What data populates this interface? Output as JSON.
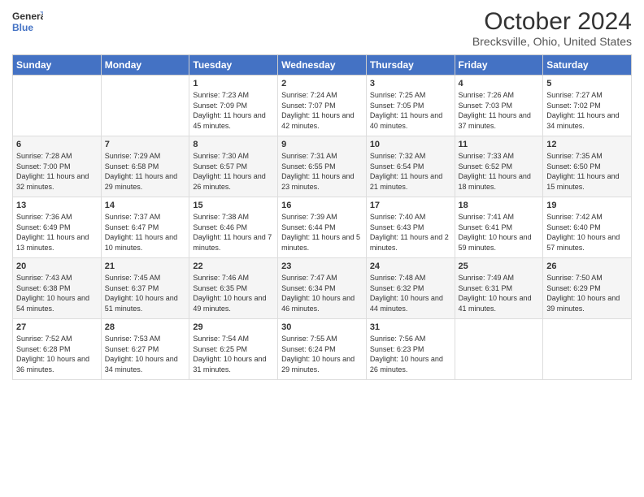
{
  "header": {
    "logo_line1": "General",
    "logo_line2": "Blue",
    "main_title": "October 2024",
    "subtitle": "Brecksville, Ohio, United States"
  },
  "weekdays": [
    "Sunday",
    "Monday",
    "Tuesday",
    "Wednesday",
    "Thursday",
    "Friday",
    "Saturday"
  ],
  "weeks": [
    [
      {
        "day": "",
        "sunrise": "",
        "sunset": "",
        "daylight": ""
      },
      {
        "day": "",
        "sunrise": "",
        "sunset": "",
        "daylight": ""
      },
      {
        "day": "1",
        "sunrise": "Sunrise: 7:23 AM",
        "sunset": "Sunset: 7:09 PM",
        "daylight": "Daylight: 11 hours and 45 minutes."
      },
      {
        "day": "2",
        "sunrise": "Sunrise: 7:24 AM",
        "sunset": "Sunset: 7:07 PM",
        "daylight": "Daylight: 11 hours and 42 minutes."
      },
      {
        "day": "3",
        "sunrise": "Sunrise: 7:25 AM",
        "sunset": "Sunset: 7:05 PM",
        "daylight": "Daylight: 11 hours and 40 minutes."
      },
      {
        "day": "4",
        "sunrise": "Sunrise: 7:26 AM",
        "sunset": "Sunset: 7:03 PM",
        "daylight": "Daylight: 11 hours and 37 minutes."
      },
      {
        "day": "5",
        "sunrise": "Sunrise: 7:27 AM",
        "sunset": "Sunset: 7:02 PM",
        "daylight": "Daylight: 11 hours and 34 minutes."
      }
    ],
    [
      {
        "day": "6",
        "sunrise": "Sunrise: 7:28 AM",
        "sunset": "Sunset: 7:00 PM",
        "daylight": "Daylight: 11 hours and 32 minutes."
      },
      {
        "day": "7",
        "sunrise": "Sunrise: 7:29 AM",
        "sunset": "Sunset: 6:58 PM",
        "daylight": "Daylight: 11 hours and 29 minutes."
      },
      {
        "day": "8",
        "sunrise": "Sunrise: 7:30 AM",
        "sunset": "Sunset: 6:57 PM",
        "daylight": "Daylight: 11 hours and 26 minutes."
      },
      {
        "day": "9",
        "sunrise": "Sunrise: 7:31 AM",
        "sunset": "Sunset: 6:55 PM",
        "daylight": "Daylight: 11 hours and 23 minutes."
      },
      {
        "day": "10",
        "sunrise": "Sunrise: 7:32 AM",
        "sunset": "Sunset: 6:54 PM",
        "daylight": "Daylight: 11 hours and 21 minutes."
      },
      {
        "day": "11",
        "sunrise": "Sunrise: 7:33 AM",
        "sunset": "Sunset: 6:52 PM",
        "daylight": "Daylight: 11 hours and 18 minutes."
      },
      {
        "day": "12",
        "sunrise": "Sunrise: 7:35 AM",
        "sunset": "Sunset: 6:50 PM",
        "daylight": "Daylight: 11 hours and 15 minutes."
      }
    ],
    [
      {
        "day": "13",
        "sunrise": "Sunrise: 7:36 AM",
        "sunset": "Sunset: 6:49 PM",
        "daylight": "Daylight: 11 hours and 13 minutes."
      },
      {
        "day": "14",
        "sunrise": "Sunrise: 7:37 AM",
        "sunset": "Sunset: 6:47 PM",
        "daylight": "Daylight: 11 hours and 10 minutes."
      },
      {
        "day": "15",
        "sunrise": "Sunrise: 7:38 AM",
        "sunset": "Sunset: 6:46 PM",
        "daylight": "Daylight: 11 hours and 7 minutes."
      },
      {
        "day": "16",
        "sunrise": "Sunrise: 7:39 AM",
        "sunset": "Sunset: 6:44 PM",
        "daylight": "Daylight: 11 hours and 5 minutes."
      },
      {
        "day": "17",
        "sunrise": "Sunrise: 7:40 AM",
        "sunset": "Sunset: 6:43 PM",
        "daylight": "Daylight: 11 hours and 2 minutes."
      },
      {
        "day": "18",
        "sunrise": "Sunrise: 7:41 AM",
        "sunset": "Sunset: 6:41 PM",
        "daylight": "Daylight: 10 hours and 59 minutes."
      },
      {
        "day": "19",
        "sunrise": "Sunrise: 7:42 AM",
        "sunset": "Sunset: 6:40 PM",
        "daylight": "Daylight: 10 hours and 57 minutes."
      }
    ],
    [
      {
        "day": "20",
        "sunrise": "Sunrise: 7:43 AM",
        "sunset": "Sunset: 6:38 PM",
        "daylight": "Daylight: 10 hours and 54 minutes."
      },
      {
        "day": "21",
        "sunrise": "Sunrise: 7:45 AM",
        "sunset": "Sunset: 6:37 PM",
        "daylight": "Daylight: 10 hours and 51 minutes."
      },
      {
        "day": "22",
        "sunrise": "Sunrise: 7:46 AM",
        "sunset": "Sunset: 6:35 PM",
        "daylight": "Daylight: 10 hours and 49 minutes."
      },
      {
        "day": "23",
        "sunrise": "Sunrise: 7:47 AM",
        "sunset": "Sunset: 6:34 PM",
        "daylight": "Daylight: 10 hours and 46 minutes."
      },
      {
        "day": "24",
        "sunrise": "Sunrise: 7:48 AM",
        "sunset": "Sunset: 6:32 PM",
        "daylight": "Daylight: 10 hours and 44 minutes."
      },
      {
        "day": "25",
        "sunrise": "Sunrise: 7:49 AM",
        "sunset": "Sunset: 6:31 PM",
        "daylight": "Daylight: 10 hours and 41 minutes."
      },
      {
        "day": "26",
        "sunrise": "Sunrise: 7:50 AM",
        "sunset": "Sunset: 6:29 PM",
        "daylight": "Daylight: 10 hours and 39 minutes."
      }
    ],
    [
      {
        "day": "27",
        "sunrise": "Sunrise: 7:52 AM",
        "sunset": "Sunset: 6:28 PM",
        "daylight": "Daylight: 10 hours and 36 minutes."
      },
      {
        "day": "28",
        "sunrise": "Sunrise: 7:53 AM",
        "sunset": "Sunset: 6:27 PM",
        "daylight": "Daylight: 10 hours and 34 minutes."
      },
      {
        "day": "29",
        "sunrise": "Sunrise: 7:54 AM",
        "sunset": "Sunset: 6:25 PM",
        "daylight": "Daylight: 10 hours and 31 minutes."
      },
      {
        "day": "30",
        "sunrise": "Sunrise: 7:55 AM",
        "sunset": "Sunset: 6:24 PM",
        "daylight": "Daylight: 10 hours and 29 minutes."
      },
      {
        "day": "31",
        "sunrise": "Sunrise: 7:56 AM",
        "sunset": "Sunset: 6:23 PM",
        "daylight": "Daylight: 10 hours and 26 minutes."
      },
      {
        "day": "",
        "sunrise": "",
        "sunset": "",
        "daylight": ""
      },
      {
        "day": "",
        "sunrise": "",
        "sunset": "",
        "daylight": ""
      }
    ]
  ]
}
